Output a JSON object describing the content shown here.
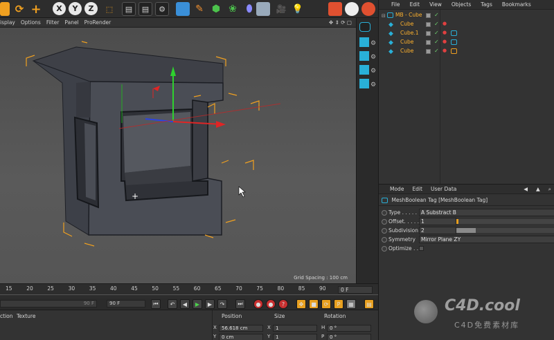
{
  "viewport_menu": [
    "isplay",
    "Options",
    "Filter",
    "Panel",
    "ProRender"
  ],
  "viewport": {
    "grid_spacing": "Grid Spacing : 100 cm"
  },
  "object_manager": {
    "menu": [
      "File",
      "Edit",
      "View",
      "Objects",
      "Tags",
      "Bookmarks"
    ],
    "objects": [
      {
        "name": "MB - Cube",
        "level": 0,
        "has_tag": false
      },
      {
        "name": "Cube",
        "level": 1,
        "has_tag": false
      },
      {
        "name": "Cube.1",
        "level": 1,
        "has_tag": true
      },
      {
        "name": "Cube",
        "level": 1,
        "has_tag": true
      },
      {
        "name": "Cube",
        "level": 1,
        "has_tag": true
      }
    ]
  },
  "attribute_manager": {
    "menu": [
      "Mode",
      "Edit",
      "User Data"
    ],
    "title": "MeshBoolean Tag [MeshBoolean Tag]",
    "params": [
      {
        "label": "Type . . . . .",
        "value": "A Substract B"
      },
      {
        "label": "Offset. . . . .",
        "value": "1",
        "slider": 0.02
      },
      {
        "label": "Subdivision",
        "value": "2",
        "slider": 0.2
      },
      {
        "label": "Symmetry",
        "value": "Mirror Plane ZY"
      },
      {
        "label": "Optimize . . .",
        "value": ""
      }
    ]
  },
  "timeline": {
    "frames": [
      "15",
      "20",
      "25",
      "30",
      "35",
      "40",
      "45",
      "50",
      "55",
      "60",
      "65",
      "70",
      "75",
      "80",
      "85",
      "90"
    ],
    "current_frame": "0 F",
    "end_frame_a": "90 F",
    "end_frame_b": "90 F"
  },
  "bottom_panel": {
    "left_headers": [
      "ction",
      "Texture"
    ],
    "headers": [
      "Position",
      "Size",
      "Rotation"
    ],
    "rows": [
      {
        "axis": "X",
        "position": "56.618 cm",
        "size_axis": "X",
        "size": "1",
        "rot_axis": "H",
        "rotation": "0 °"
      },
      {
        "axis": "Y",
        "position": "0 cm",
        "size_axis": "Y",
        "size": "1",
        "rot_axis": "P",
        "rotation": "0 °"
      }
    ]
  },
  "watermark": {
    "brand": "C4D.cool",
    "subtitle": "C4D免费素材库"
  },
  "colors": {
    "accent_orange": "#ffb22e",
    "accent_cyan": "#29b0d8",
    "check_green": "#6fd16f"
  }
}
